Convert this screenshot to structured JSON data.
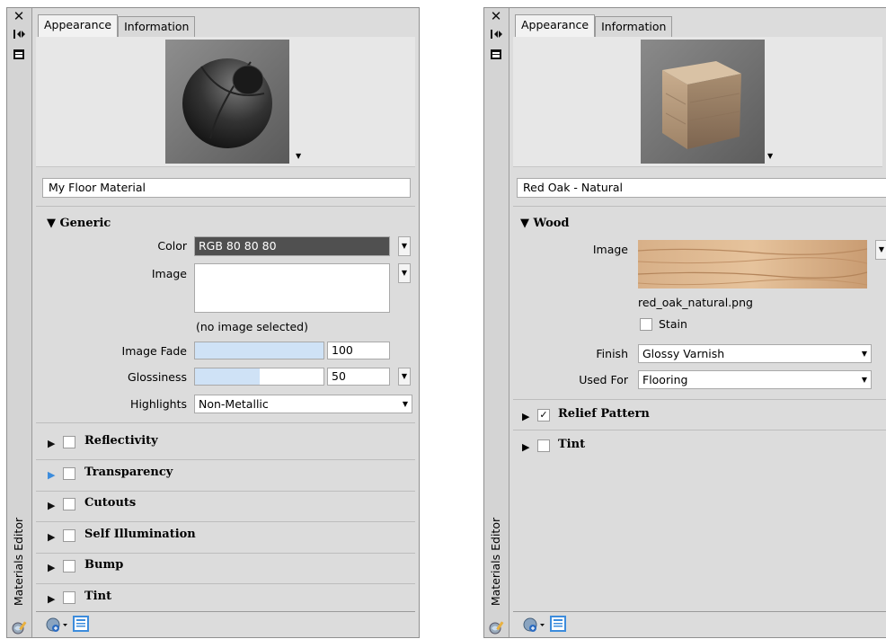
{
  "strip": {
    "title": "Materials Editor"
  },
  "panel1": {
    "tabs": [
      "Appearance",
      "Information"
    ],
    "name": "My Floor Material",
    "generic": {
      "header": "Generic",
      "color_label": "Color",
      "color_value": "RGB 80 80 80",
      "color_hex": "#505050",
      "image_label": "Image",
      "no_image": "(no image selected)",
      "image_fade_label": "Image Fade",
      "image_fade_value": "100",
      "image_fade_fraction": 1.0,
      "glossiness_label": "Glossiness",
      "glossiness_value": "50",
      "glossiness_fraction": 0.5,
      "highlights_label": "Highlights",
      "highlights_value": "Non-Metallic"
    },
    "sections": [
      "Reflectivity",
      "Transparency",
      "Cutouts",
      "Self Illumination",
      "Bump",
      "Tint"
    ]
  },
  "panel2": {
    "tabs": [
      "Appearance",
      "Information"
    ],
    "name": "Red Oak - Natural",
    "wood": {
      "header": "Wood",
      "image_label": "Image",
      "image_file": "red_oak_natural.png",
      "stain_label": "Stain",
      "finish_label": "Finish",
      "finish_value": "Glossy Varnish",
      "used_for_label": "Used For",
      "used_for_value": "Flooring"
    },
    "sections": [
      "Relief Pattern",
      "Tint"
    ]
  },
  "colors": {
    "panel_bg": "#dcdcdc",
    "accent_blue": "#3c8cdc",
    "slider_fill": "#cfe2f6"
  }
}
